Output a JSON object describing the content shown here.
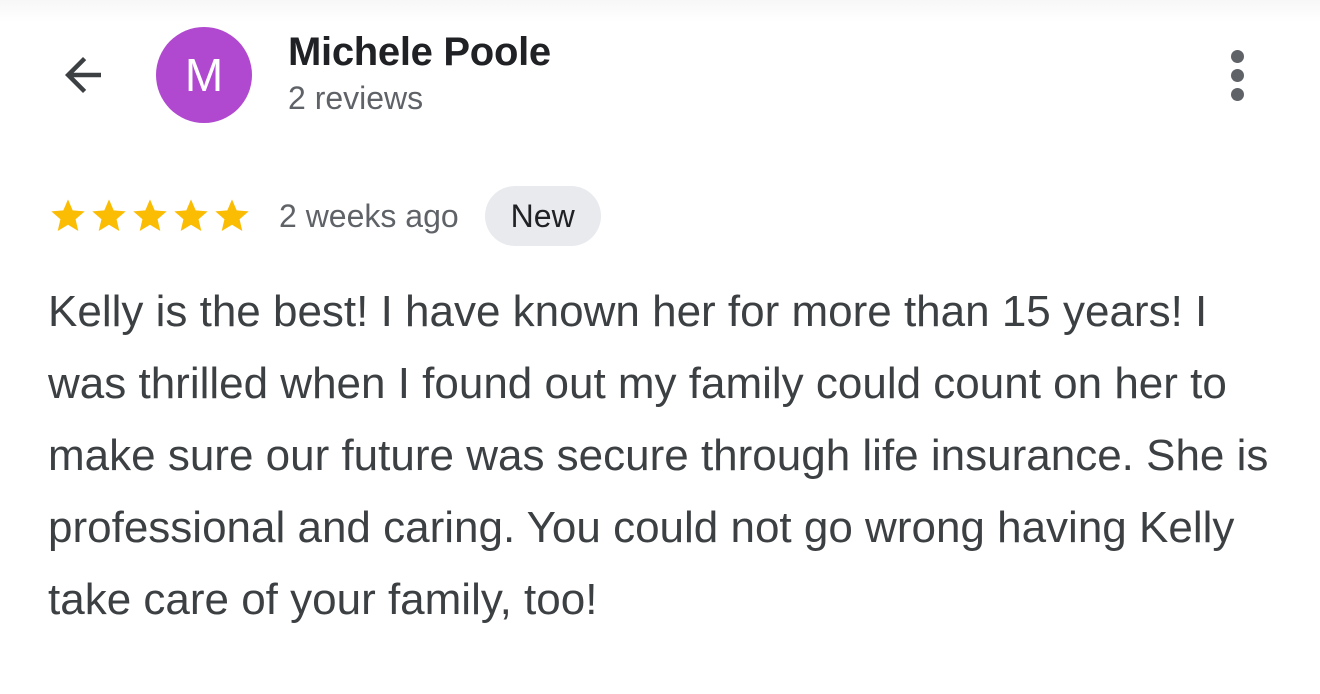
{
  "header": {
    "back_icon": "arrow-back-icon",
    "avatar_letter": "M",
    "avatar_color": "#b049cf",
    "reviewer_name": "Michele Poole",
    "review_count": "2 reviews",
    "more_icon": "more-vert-icon"
  },
  "review": {
    "rating": 5,
    "rating_max": 5,
    "star_color": "#fbbc04",
    "time_ago": "2 weeks ago",
    "badge": "New",
    "text": "Kelly is the best! I have known her for more than 15 years! I was thrilled when I found out my family could count on her to make sure our future was secure through life insurance. She is professional and caring. You could not go wrong having Kelly take care of your family, too!"
  }
}
